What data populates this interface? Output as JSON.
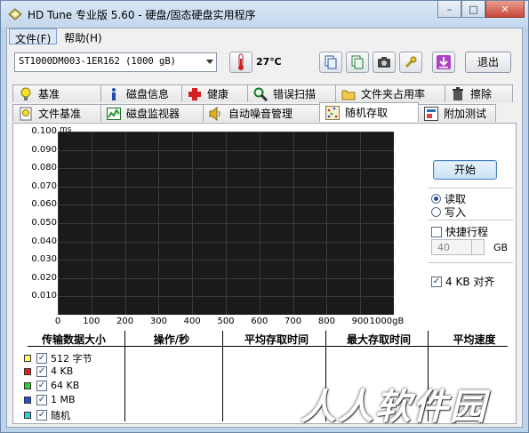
{
  "window": {
    "title": "HD Tune 专业版 5.60 - 硬盘/固态硬盘实用程序",
    "minimize": "–",
    "maximize": "□",
    "close": "✕"
  },
  "menu": {
    "file": "文件(F)",
    "help": "帮助(H)"
  },
  "toolbar": {
    "drive": "ST1000DM003-1ER162 (1000 gB)",
    "temperature": "27℃",
    "exit": "退出"
  },
  "tabs_row1": [
    {
      "label": "基准",
      "icon": "bulb-icon"
    },
    {
      "label": "磁盘信息",
      "icon": "info-icon"
    },
    {
      "label": "健康",
      "icon": "health-cross-icon"
    },
    {
      "label": "错误扫描",
      "icon": "magnifier-icon"
    },
    {
      "label": "文件夹占用率",
      "icon": "folder-icon"
    },
    {
      "label": "擦除",
      "icon": "trash-icon"
    }
  ],
  "tabs_row2": [
    {
      "label": "文件基准",
      "icon": "bulb-doc-icon"
    },
    {
      "label": "磁盘监视器",
      "icon": "monitor-chart-icon"
    },
    {
      "label": "自动噪音管理",
      "icon": "speaker-icon"
    },
    {
      "label": "随机存取",
      "icon": "random-dots-icon",
      "active": true
    },
    {
      "label": "附加测试",
      "icon": "extra-test-icon"
    }
  ],
  "chart_data": {
    "type": "scatter",
    "ylabel": "ms",
    "y_ticks": [
      "0.100",
      "0.090",
      "0.080",
      "0.070",
      "0.060",
      "0.050",
      "0.040",
      "0.030",
      "0.020",
      "0.010"
    ],
    "x_ticks": [
      "0",
      "100",
      "200",
      "300",
      "400",
      "500",
      "600",
      "700",
      "800",
      "900",
      "1000gB"
    ],
    "xlim": [
      0,
      1000
    ],
    "ylim": [
      0,
      0.1
    ],
    "grid": true,
    "series": []
  },
  "controls": {
    "start": "开始",
    "read": "读取",
    "write": "写入",
    "quick_stroke": "快捷行程",
    "quick_value": "40",
    "gb": "GB",
    "align": "4 KB 对齐"
  },
  "table": {
    "headers": [
      "传输数据大小",
      "操作/秒",
      "平均存取时间",
      "最大存取时间",
      "平均速度"
    ],
    "rows": [
      {
        "label": "512 字节",
        "color": "#ffff66"
      },
      {
        "label": "4 KB",
        "color": "#dd2222"
      },
      {
        "label": "64 KB",
        "color": "#33cc33"
      },
      {
        "label": "1 MB",
        "color": "#2255cc"
      },
      {
        "label": "随机",
        "color": "#33ccdd"
      }
    ]
  }
}
